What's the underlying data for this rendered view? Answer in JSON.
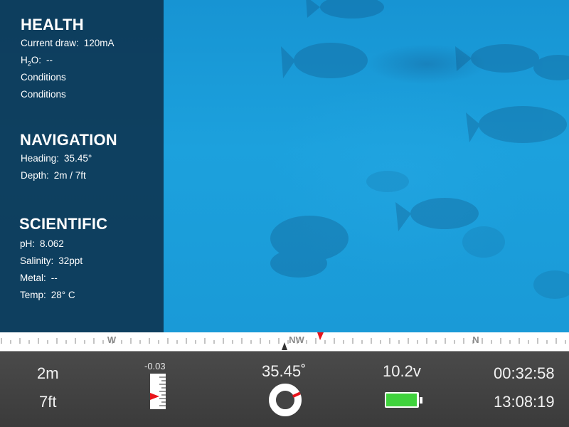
{
  "panel": {
    "health": {
      "title": "HEALTH",
      "current_draw_label": "Current draw:",
      "current_draw_value": "120mA",
      "h2o_label_prefix": "H",
      "h2o_label_sub": "2",
      "h2o_label_suffix": "O:",
      "h2o_value": "--",
      "conditions_1": "Conditions",
      "conditions_2": "Conditions"
    },
    "navigation": {
      "title": "NAVIGATION",
      "heading_label": "Heading:",
      "heading_value": "35.45°",
      "depth_label": "Depth:",
      "depth_value": "2m / 7ft"
    },
    "scientific": {
      "title": "SCIENTIFIC",
      "ph_label": "pH:",
      "ph_value": "8.062",
      "salinity_label": "Salinity:",
      "salinity_value": "32ppt",
      "metal_label": "Metal:",
      "metal_value": "--",
      "temp_label": "Temp:",
      "temp_value": "28° C"
    }
  },
  "compass": {
    "labels": [
      "W",
      "NW",
      "N"
    ],
    "marker_color": "#e8141b"
  },
  "readouts": {
    "depth_m": "2m",
    "depth_ft": "7ft",
    "vertical_rate": "-0.03",
    "heading": "35.45˚",
    "heading_degrees": 35.45,
    "voltage": "10.2v",
    "elapsed_time": "00:32:58",
    "clock_time": "13:08:19"
  },
  "colors": {
    "panel": "#0c2d48",
    "water": "#1a9ad6",
    "bar": "#404040",
    "battery_fill": "#3fd23c",
    "alert_red": "#e8141b"
  },
  "icons": {
    "heading_dial": "heading-dial-icon",
    "battery": "battery-icon",
    "depth_gauge": "depth-gauge-icon"
  }
}
